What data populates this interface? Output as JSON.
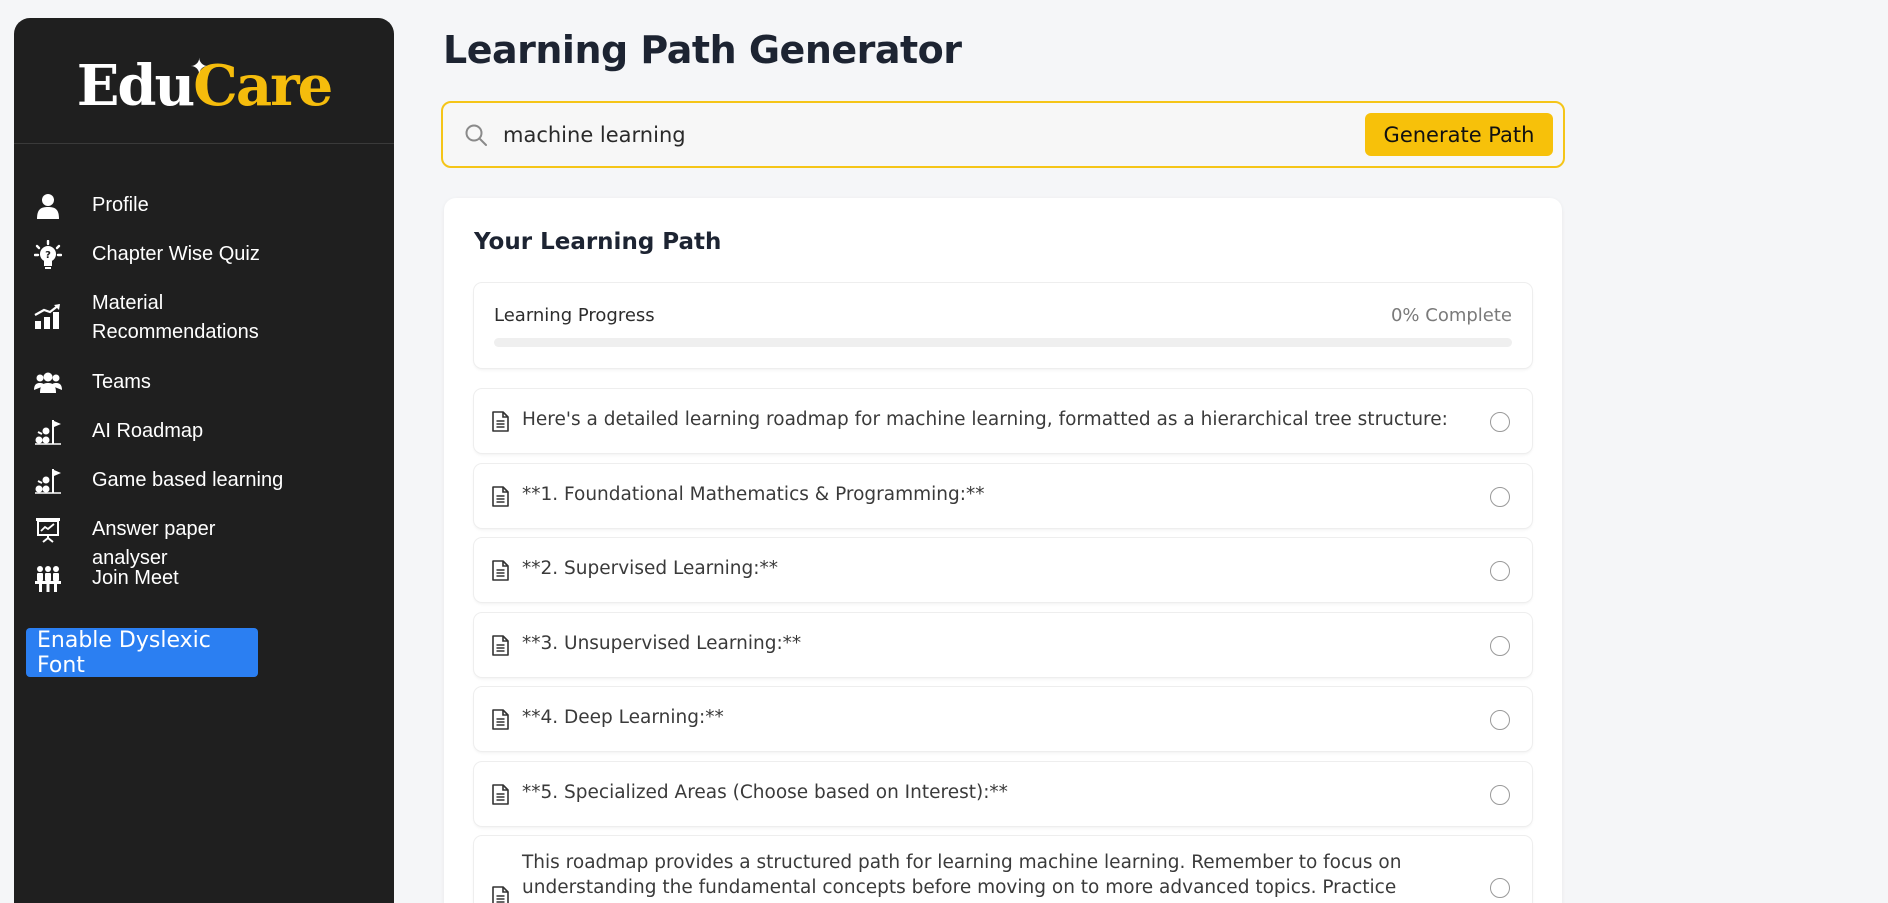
{
  "sidebar": {
    "logo": {
      "part1": "Edu",
      "part2": "Care"
    },
    "items": [
      {
        "label": "Profile",
        "icon": "user-icon"
      },
      {
        "label": "Chapter Wise Quiz",
        "icon": "lightbulb-gear-icon"
      },
      {
        "label": "Material Recommendations",
        "icon": "bar-chart-growth-icon"
      },
      {
        "label": "Teams",
        "icon": "users-group-icon"
      },
      {
        "label": "AI Roadmap",
        "icon": "roadmap-icon"
      },
      {
        "label": "Game based learning",
        "icon": "roadmap-icon"
      },
      {
        "label": "Answer paper analyser",
        "icon": "presentation-board-icon"
      },
      {
        "label": "Join Meet",
        "icon": "people-meeting-icon"
      }
    ],
    "dyslexic_button": "Enable Dyslexic Font"
  },
  "main": {
    "title": "Learning Path Generator",
    "search": {
      "value": "machine learning"
    },
    "generate_button": "Generate Path",
    "path_card": {
      "title": "Your Learning Path",
      "progress": {
        "label": "Learning Progress",
        "value_text": "0% Complete",
        "percent": 0
      },
      "steps": [
        "Here's a detailed learning roadmap for machine learning, formatted as a hierarchical tree structure:",
        "**1. Foundational Mathematics & Programming:**",
        "**2. Supervised Learning:**",
        "**3. Unsupervised Learning:**",
        "**4. Deep Learning:**",
        "**5. Specialized Areas (Choose based on Interest):**",
        "This roadmap provides a structured path for learning machine learning. Remember to focus on understanding the fundamental concepts before moving on to more advanced topics. Practice regularly"
      ]
    }
  },
  "colors": {
    "accent": "#f7c10a",
    "sidebar_bg": "#1f1f1f",
    "button_blue": "#2b7ff2",
    "page_bg": "#f5f6f8"
  }
}
